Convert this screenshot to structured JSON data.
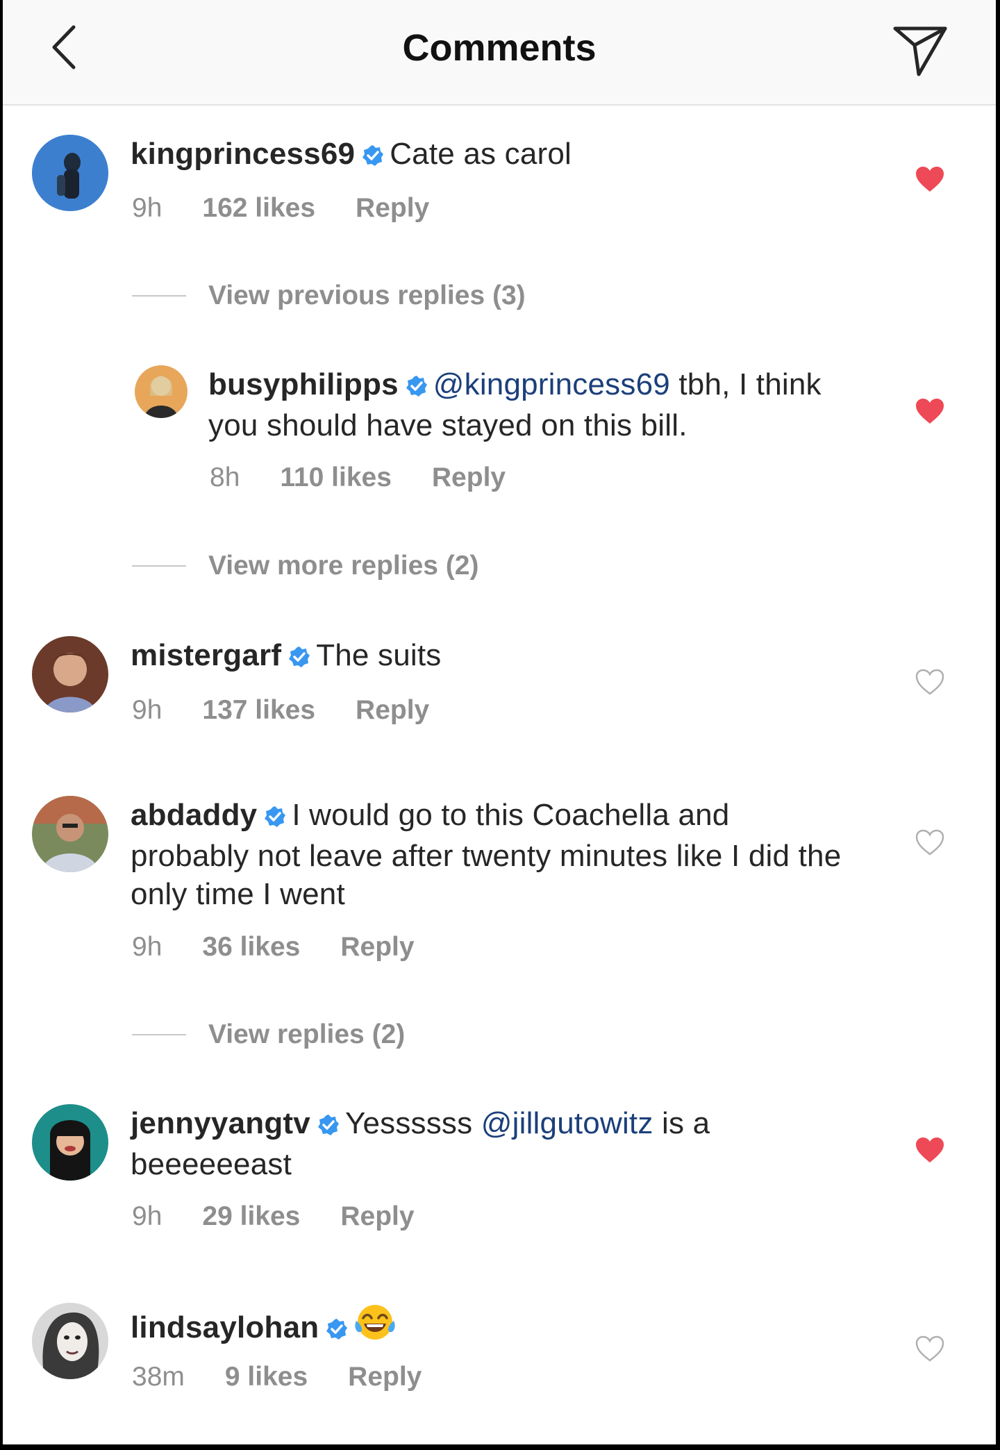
{
  "header": {
    "title": "Comments",
    "back_icon": "chevron-left-icon",
    "send_icon": "paper-plane-icon"
  },
  "colors": {
    "verified": "#3897f0",
    "heart_liked": "#ed4956",
    "meta_gray": "#8e8e8e",
    "mention": "#1b3f7a"
  },
  "comments": [
    {
      "username": "kingprincess69",
      "verified": true,
      "text": "Cate as carol",
      "time": "9h",
      "likes": "162 likes",
      "reply": "Reply",
      "liked": true,
      "view_previous": "View previous replies (3)",
      "reply_item": {
        "username": "busyphilipps",
        "verified": true,
        "mention": "@kingprincess69",
        "text_after": " tbh, I think you should have stayed on this bill.",
        "time": "8h",
        "likes": "110 likes",
        "reply": "Reply",
        "liked": true
      },
      "view_more": "View more replies (2)"
    },
    {
      "username": "mistergarf",
      "verified": true,
      "text": "The suits",
      "time": "9h",
      "likes": "137 likes",
      "reply": "Reply",
      "liked": false
    },
    {
      "username": "abdaddy",
      "verified": true,
      "text": "I would go to this Coachella and probably not leave after twenty minutes like I did the only time I went",
      "time": "9h",
      "likes": "36 likes",
      "reply": "Reply",
      "liked": false,
      "view_replies": "View replies (2)"
    },
    {
      "username": "jennyyangtv",
      "verified": true,
      "text_before": "Yessssss ",
      "mention": "@jillgutowitz",
      "text_after": " is a beeeeeeast",
      "time": "9h",
      "likes": "29 likes",
      "reply": "Reply",
      "liked": true
    },
    {
      "username": "lindsaylohan",
      "verified": true,
      "emoji": "face-with-tears-of-joy-emoji",
      "time": "38m",
      "likes": "9 likes",
      "reply": "Reply",
      "liked": false
    }
  ]
}
